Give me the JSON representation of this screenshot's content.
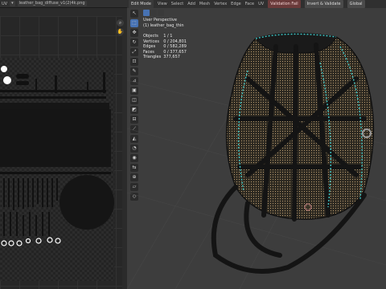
{
  "uv_editor": {
    "header": {
      "editor_type": "UV",
      "image_name": "leather_bag_diffuse_v1(2)4k.png"
    }
  },
  "viewport": {
    "header": {
      "mode": "Edit Mode",
      "menus": [
        "View",
        "Select",
        "Add",
        "Mesh",
        "Vertex",
        "Edge",
        "Face",
        "UV"
      ],
      "validation_label": "Validation Fail",
      "invert_label": "Invert & Validate",
      "global_label": "Global"
    },
    "overlay": {
      "perspective": "User Perspective",
      "object_name": "(1) leather_bag_thin",
      "stats": [
        {
          "label": "Objects",
          "value": "1 / 1"
        },
        {
          "label": "Vertices",
          "value": "0 / 204,801"
        },
        {
          "label": "Edges",
          "value": "0 / 582,289"
        },
        {
          "label": "Faces",
          "value": "0 / 377,657"
        },
        {
          "label": "Triangles",
          "value": "377,657"
        }
      ]
    }
  },
  "colors": {
    "uv_bg": "#2b2b2b",
    "viewport_bg": "#3d3d3d",
    "accent": "#4772b3",
    "seam": "#3ec7c7",
    "mesh": "#b89a70"
  },
  "icons": [
    "zoom-icon",
    "hand-icon",
    "cursor-icon",
    "move-icon",
    "rotate-icon",
    "scale-icon",
    "transform-icon",
    "annotate-icon",
    "measure-icon",
    "extrude-icon",
    "inset-icon",
    "bevel-icon",
    "loopcut-icon",
    "knife-icon",
    "polybuild-icon",
    "spin-icon",
    "smooth-icon",
    "edge-slide-icon",
    "shrink-icon",
    "shear-icon",
    "rip-icon"
  ]
}
